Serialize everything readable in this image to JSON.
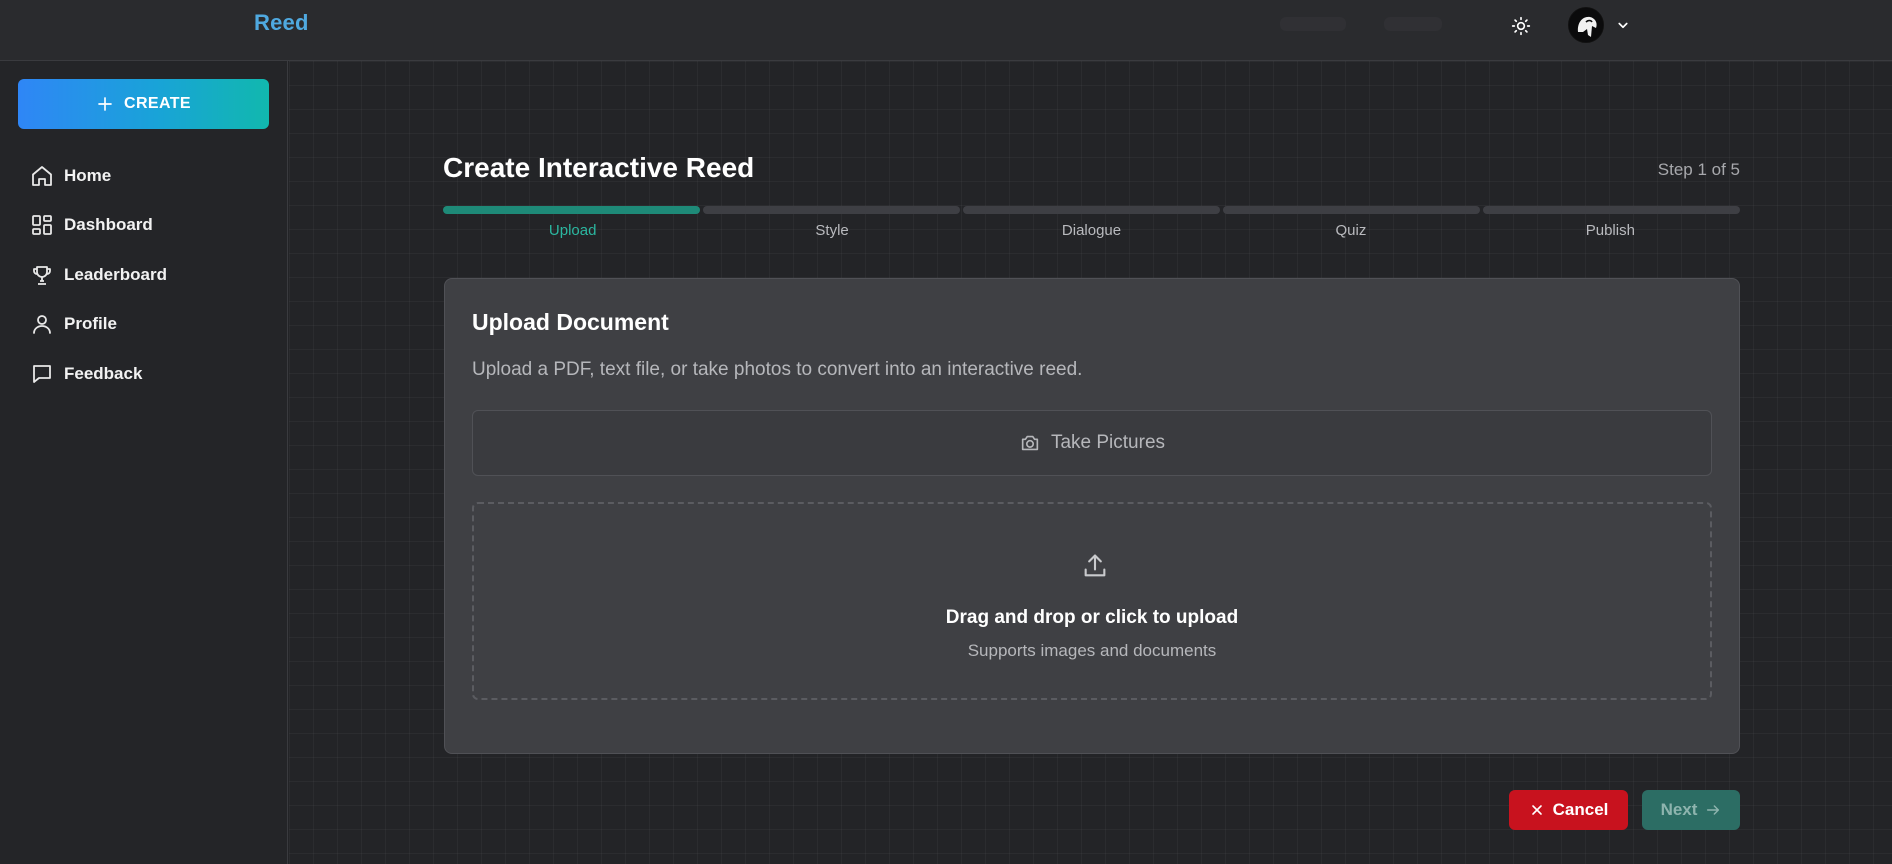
{
  "app": {
    "logo": "Reed"
  },
  "sidebar": {
    "create_label": "CREATE",
    "items": [
      {
        "label": "Home",
        "icon": "home-icon"
      },
      {
        "label": "Dashboard",
        "icon": "dashboard-icon"
      },
      {
        "label": "Leaderboard",
        "icon": "trophy-icon"
      },
      {
        "label": "Profile",
        "icon": "user-icon"
      },
      {
        "label": "Feedback",
        "icon": "message-icon"
      }
    ]
  },
  "page": {
    "title": "Create Interactive Reed",
    "step_indicator": "Step 1 of 5",
    "steps": [
      "Upload",
      "Style",
      "Dialogue",
      "Quiz",
      "Publish"
    ],
    "active_step": 0
  },
  "card": {
    "title": "Upload Document",
    "description": "Upload a PDF, text file, or take photos to convert into an interactive reed.",
    "take_pictures_label": "Take Pictures",
    "dropzone_title": "Drag and drop or click to upload",
    "dropzone_subtitle": "Supports images and documents"
  },
  "actions": {
    "cancel_label": "Cancel",
    "next_label": "Next"
  },
  "colors": {
    "accent": "#1e8a78",
    "active_step_text": "#2bb7a0",
    "cancel": "#c8121e",
    "next": "#2c6d64",
    "logo": "#4fa9e0"
  }
}
